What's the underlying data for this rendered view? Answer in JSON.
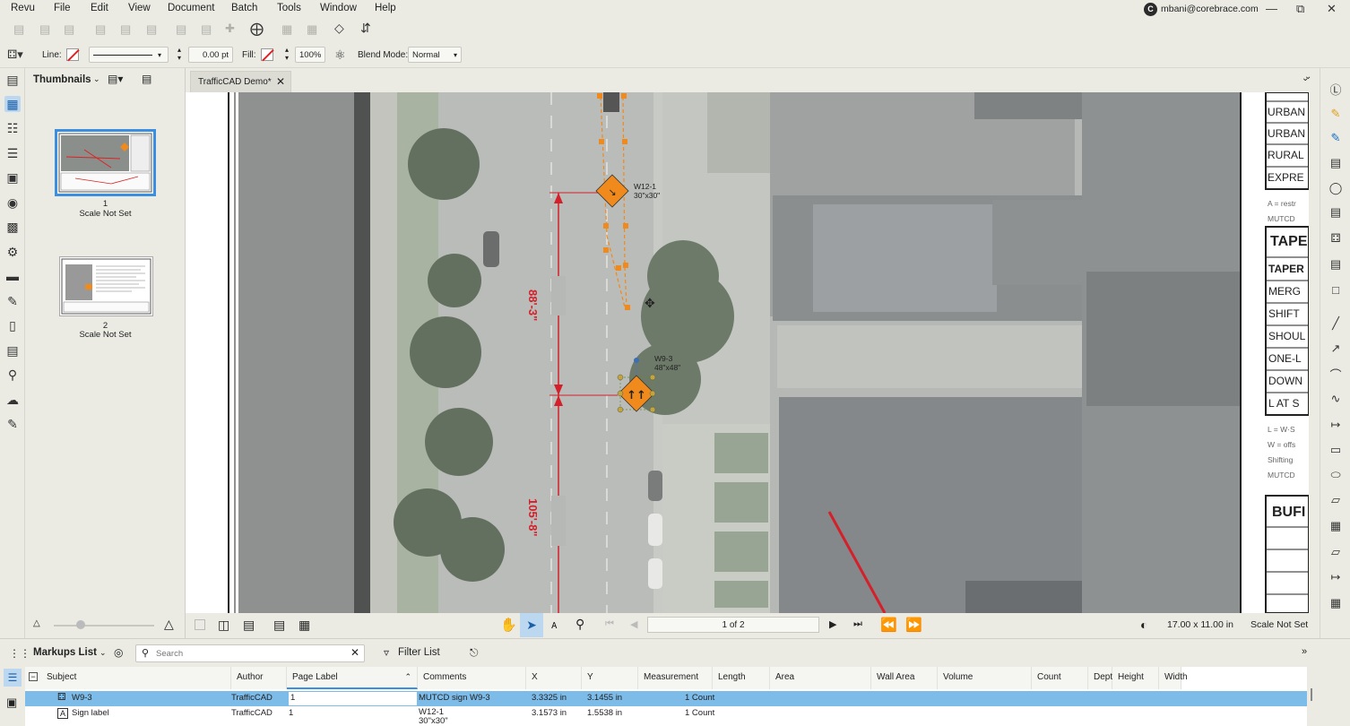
{
  "menubar": {
    "items": [
      "Revu",
      "File",
      "Edit",
      "View",
      "Document",
      "Batch",
      "Tools",
      "Window",
      "Help"
    ],
    "user_email": "mbani@corebrace.com",
    "user_initial": "C"
  },
  "props": {
    "line_label": "Line:",
    "line_width": "0.00 pt",
    "fill_label": "Fill:",
    "opacity": "100%",
    "blend_label": "Blend Mode:",
    "blend_value": "Normal"
  },
  "thumbs": {
    "title": "Thumbnails",
    "pages": [
      {
        "num": "1",
        "scale": "Scale Not Set"
      },
      {
        "num": "2",
        "scale": "Scale Not Set"
      }
    ]
  },
  "tab": {
    "label": "TrafficCAD Demo*"
  },
  "drawing": {
    "sign1_code": "W12-1",
    "sign1_size": "30\"x30\"",
    "sign2_code": "W9-3",
    "sign2_size": "48\"x48\"",
    "dim1": "88'-3\"",
    "dim2": "105'-8\"",
    "side_rows": [
      "URBAN",
      "URBAN",
      "RURAL",
      "EXPRE"
    ],
    "note1": "A = restr",
    "note2": "MUTCD",
    "heading": "TAPE",
    "rows2": [
      "TAPER",
      "MERG",
      "SHIFT",
      "SHOUL",
      "ONE-L",
      "DOWN",
      "L AT S"
    ],
    "notes2": [
      "L = W·S",
      "W = offs",
      "Shifting",
      "MUTCD"
    ],
    "heading2": "BUFI"
  },
  "status": {
    "page_input": "1 of 2",
    "page_size": "17.00 x 11.00 in",
    "scale": "Scale Not Set"
  },
  "markups": {
    "title": "Markups List",
    "search_placeholder": "Search",
    "filter_label": "Filter List",
    "columns": [
      "Subject",
      "Author",
      "Page Label",
      "Comments",
      "X",
      "Y",
      "Measurement",
      "Length",
      "Area",
      "Wall Area",
      "Volume",
      "Count",
      "Depth",
      "Height",
      "Width"
    ],
    "rows": [
      {
        "subject": "W9-3",
        "author": "TrafficCAD",
        "page": "1",
        "comments": "MUTCD sign W9-3",
        "x": "3.3325 in",
        "y": "3.1455 in",
        "measurement": "1 Count",
        "selected": true
      },
      {
        "subject": "Sign label",
        "author": "TrafficCAD",
        "page": "1",
        "comments": "W12-1",
        "comments2": "30\"x30\"",
        "x": "3.1573 in",
        "y": "1.5538 in",
        "measurement": "1 Count",
        "selected": false
      }
    ]
  },
  "colors": {
    "accent": "#1a6fc2",
    "selected_row": "#7dbbe8",
    "dimension": "#d4202a",
    "sign": "#f08a1c"
  }
}
